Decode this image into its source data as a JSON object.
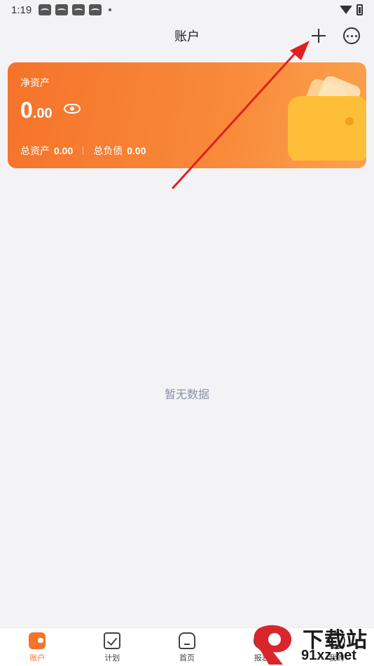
{
  "status_bar": {
    "time": "1:19"
  },
  "header": {
    "title": "账户",
    "add_icon": "plus-icon",
    "more_icon": "more-circle-icon"
  },
  "asset_card": {
    "label": "净资产",
    "net_value_int": "0",
    "net_value_dec": ".00",
    "total_assets_label": "总资产",
    "total_assets_value": "0.00",
    "total_liabilities_label": "总负债",
    "total_liabilities_value": "0.00",
    "colors": {
      "start": "#f5732a",
      "end": "#fba24e"
    }
  },
  "empty_state": {
    "text": "暂无数据"
  },
  "bottom_nav": {
    "items": [
      {
        "label": "账户",
        "icon": "wallet-icon",
        "active": true
      },
      {
        "label": "计划",
        "icon": "checkbox-icon",
        "active": false
      },
      {
        "label": "首页",
        "icon": "home-icon",
        "active": false
      },
      {
        "label": "报表",
        "icon": "report-icon",
        "active": false
      },
      {
        "label": "我的",
        "icon": "user-icon",
        "active": false
      }
    ]
  },
  "watermark": {
    "line1": "下载站",
    "line2": "91xz.net"
  },
  "colors": {
    "accent": "#f5732a",
    "background": "#f3f3f6",
    "annotation": "#e02020"
  }
}
